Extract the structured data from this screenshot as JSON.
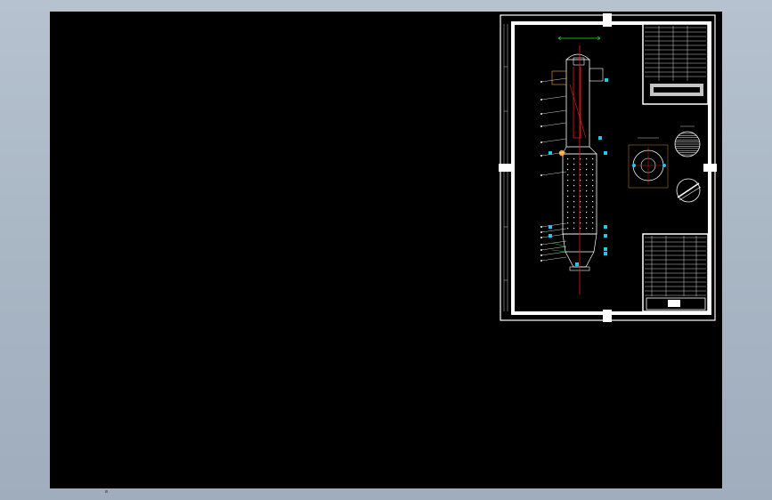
{
  "viewport": {
    "background_color": "#000000",
    "sheet_border_color": "#ffffff",
    "accent_colors": {
      "centerline": "#e02020",
      "dimension": "#2ee82e",
      "balloon": "#22c6e6",
      "outline": "#ffffff",
      "nozzle": "#f2a640"
    }
  },
  "drawing": {
    "description_icons": [
      "column-vessel-elevation",
      "top-view-circle",
      "tray-plan-circle",
      "section-circle"
    ]
  }
}
